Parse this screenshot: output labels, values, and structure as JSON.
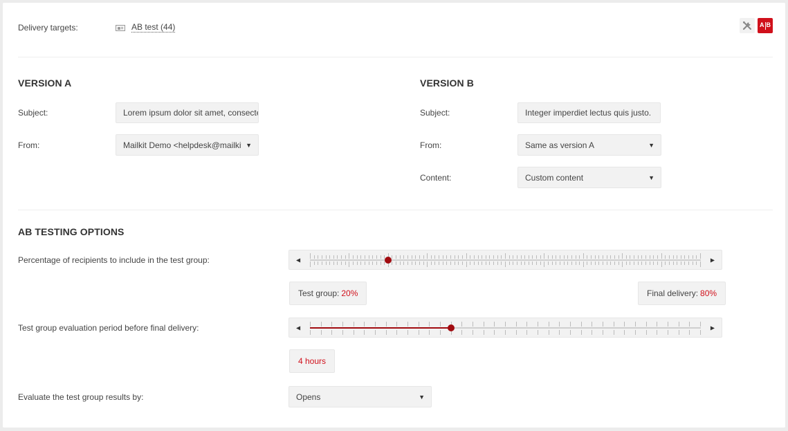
{
  "delivery": {
    "label": "Delivery targets:",
    "target_icon": "contact-card-icon",
    "target_link": "AB test (44)"
  },
  "toolbar": {
    "tools_icon": "tools-icon",
    "ab_icon": "ab-test-icon",
    "ab_left": "A",
    "ab_right": "B",
    "accent_color": "#d0101b"
  },
  "version_a": {
    "heading": "VERSION A",
    "subject_label": "Subject:",
    "subject_value": "Lorem ipsum dolor sit amet, consectetur",
    "from_label": "From:",
    "from_value": "Mailkit Demo <helpdesk@mailkit.eu>"
  },
  "version_b": {
    "heading": "VERSION B",
    "subject_label": "Subject:",
    "subject_value": "Integer imperdiet lectus quis justo.",
    "from_label": "From:",
    "from_value": "Same as version A",
    "content_label": "Content:",
    "content_value": "Custom content"
  },
  "ab_options": {
    "heading": "AB TESTING OPTIONS",
    "percentage_label": "Percentage of recipients to include in the test group:",
    "percentage_slider": {
      "value_percent": 20,
      "min": 0,
      "max": 100,
      "minor_step": 1,
      "major_step": 10
    },
    "test_group_label": "Test group: ",
    "test_group_value": "20%",
    "final_delivery_label": "Final delivery: ",
    "final_delivery_value": "80%",
    "period_label": "Test group evaluation period before final delivery:",
    "period_slider": {
      "steps": 36,
      "value_step": 13
    },
    "period_value": "4 hours",
    "evaluate_label": "Evaluate the test group results by:",
    "evaluate_value": "Opens"
  },
  "icons": {
    "caret": "▼",
    "arrow_left": "◀",
    "arrow_right": "▶"
  }
}
